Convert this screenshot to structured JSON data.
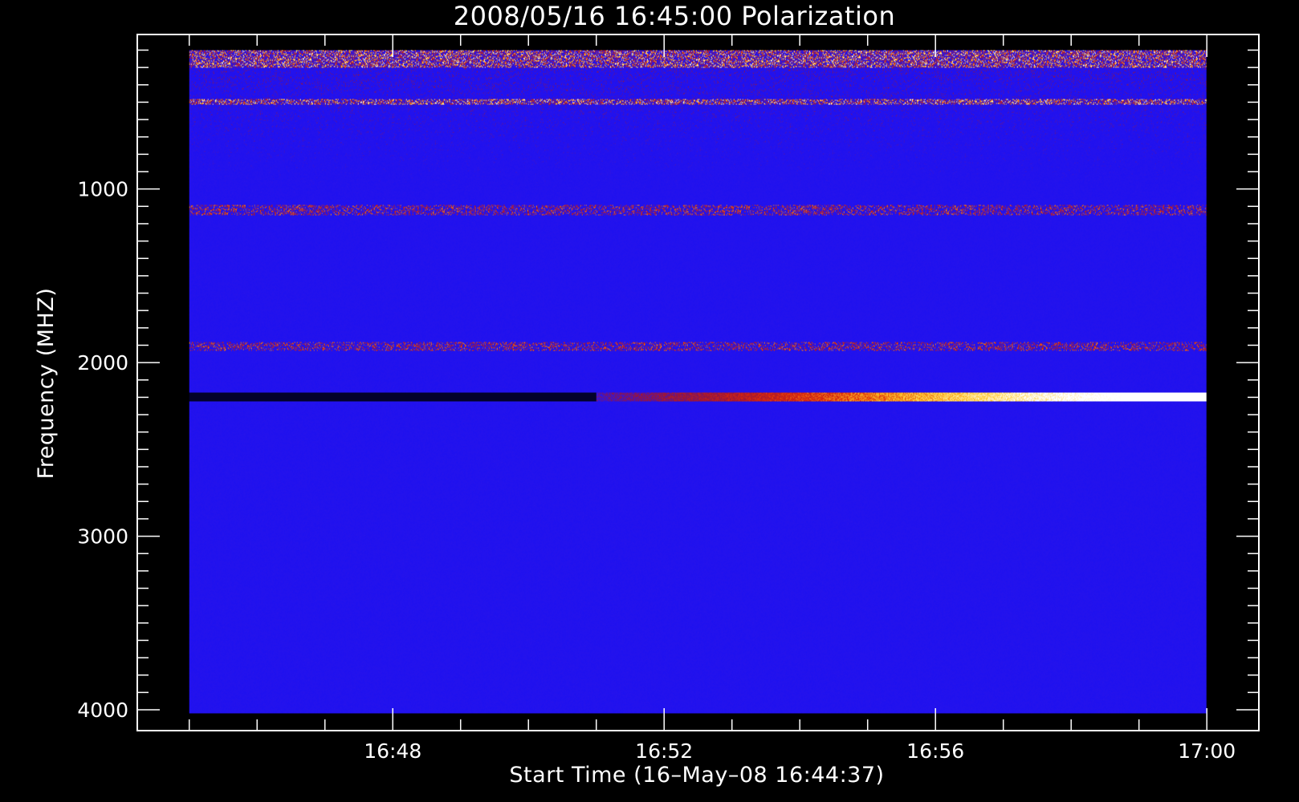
{
  "chart_data": {
    "type": "heatmap",
    "title": "2008/05/16 16:45:00 Polarization",
    "xlabel": "Start Time (16–May–08 16:44:37)",
    "ylabel": "Frequency (MHZ)",
    "x_tick_labels": [
      "16:48",
      "16:52",
      "16:56",
      "17:00"
    ],
    "x_tick_minutes": [
      3.383,
      7.383,
      11.383,
      15.383
    ],
    "x_minor_minutes": [
      0.383,
      1.383,
      2.383,
      3.383,
      4.383,
      5.383,
      6.383,
      7.383,
      8.383,
      9.383,
      10.383,
      11.383,
      12.383,
      13.383,
      14.383,
      15.383
    ],
    "xlim_minutes": [
      -0.383,
      16.15
    ],
    "data_x_range_minutes": [
      0.383,
      15.383
    ],
    "y_ticks": [
      1000,
      2000,
      3000,
      4000
    ],
    "y_tick_labels": [
      "1000",
      "2000",
      "3000",
      "4000"
    ],
    "ylim": [
      4120,
      110
    ],
    "data_y_range": [
      4020,
      200
    ],
    "y_reversed": true,
    "colors": {
      "background": "#000000",
      "axes": "#ffffff",
      "low": "#1c10f0",
      "mid": "#c42418",
      "high": "#ffffff"
    },
    "features": [
      {
        "label": "bursty emission bands",
        "freq_range": [
          200,
          300
        ],
        "time_range": [
          0.383,
          15.383
        ],
        "intensity": "high"
      },
      {
        "label": "bursty emission band",
        "freq_range": [
          480,
          510
        ],
        "time_range": [
          0.383,
          15.383
        ],
        "intensity": "high"
      },
      {
        "label": "speckled band",
        "freq_range": [
          1090,
          1150
        ],
        "time_range": [
          0.383,
          15.383
        ],
        "intensity": "medium"
      },
      {
        "label": "interference line",
        "freq_range": [
          1880,
          1930
        ],
        "time_range": [
          0.383,
          15.383
        ],
        "intensity": "medium"
      },
      {
        "label": "brightening line",
        "freq_range": [
          2170,
          2220
        ],
        "time_range": [
          0.383,
          15.383
        ],
        "intensity": "rising"
      }
    ]
  }
}
